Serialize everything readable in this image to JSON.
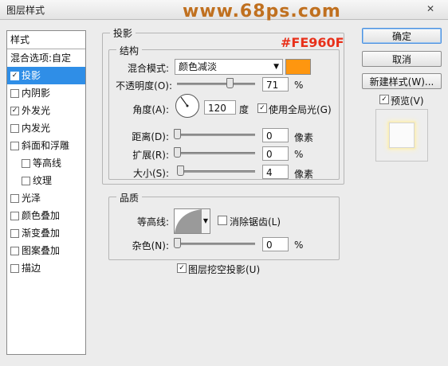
{
  "window": {
    "title": "图层样式",
    "close_label": "✕"
  },
  "watermark": "www.68ps.com",
  "left_panel": {
    "header": "样式",
    "items": [
      {
        "label": "混合选项:自定",
        "checkbox": false,
        "has_checkbox": false,
        "indent": false,
        "selected": false
      },
      {
        "label": "投影",
        "checkbox": true,
        "has_checkbox": true,
        "indent": false,
        "selected": true
      },
      {
        "label": "内阴影",
        "checkbox": false,
        "has_checkbox": true,
        "indent": false,
        "selected": false
      },
      {
        "label": "外发光",
        "checkbox": true,
        "has_checkbox": true,
        "indent": false,
        "selected": false
      },
      {
        "label": "内发光",
        "checkbox": false,
        "has_checkbox": true,
        "indent": false,
        "selected": false
      },
      {
        "label": "斜面和浮雕",
        "checkbox": false,
        "has_checkbox": true,
        "indent": false,
        "selected": false
      },
      {
        "label": "等高线",
        "checkbox": false,
        "has_checkbox": true,
        "indent": true,
        "selected": false
      },
      {
        "label": "纹理",
        "checkbox": false,
        "has_checkbox": true,
        "indent": true,
        "selected": false
      },
      {
        "label": "光泽",
        "checkbox": false,
        "has_checkbox": true,
        "indent": false,
        "selected": false
      },
      {
        "label": "颜色叠加",
        "checkbox": false,
        "has_checkbox": true,
        "indent": false,
        "selected": false
      },
      {
        "label": "渐变叠加",
        "checkbox": false,
        "has_checkbox": true,
        "indent": false,
        "selected": false
      },
      {
        "label": "图案叠加",
        "checkbox": false,
        "has_checkbox": true,
        "indent": false,
        "selected": false
      },
      {
        "label": "描边",
        "checkbox": false,
        "has_checkbox": true,
        "indent": false,
        "selected": false
      }
    ]
  },
  "shadow_section": {
    "title": "投影",
    "structure_title": "结构",
    "blend_mode_label": "混合模式:",
    "blend_mode_value": "颜色减淡",
    "color_hex_label": "#FE960F",
    "color": "#FE960F",
    "opacity_label": "不透明度(O):",
    "opacity_value": "71",
    "opacity_unit": "%",
    "opacity_fraction": 0.71,
    "angle_label": "角度(A):",
    "angle_value": "120",
    "angle_unit": "度",
    "use_global_light_label": "使用全局光(G)",
    "use_global_light": true,
    "distance_label": "距离(D):",
    "distance_value": "0",
    "distance_unit": "像素",
    "spread_label": "扩展(R):",
    "spread_value": "0",
    "spread_unit": "%",
    "size_label": "大小(S):",
    "size_value": "4",
    "size_unit": "像素",
    "quality_title": "品质",
    "contour_label": "等高线:",
    "anti_alias_label": "消除锯齿(L)",
    "anti_alias": false,
    "noise_label": "杂色(N):",
    "noise_value": "0",
    "noise_unit": "%",
    "knockout_label": "图层挖空投影(U)",
    "knockout": true
  },
  "buttons": {
    "ok": "确定",
    "cancel": "取消",
    "new_style": "新建样式(W)...",
    "preview_label": "预览(V)",
    "preview_checked": true
  }
}
